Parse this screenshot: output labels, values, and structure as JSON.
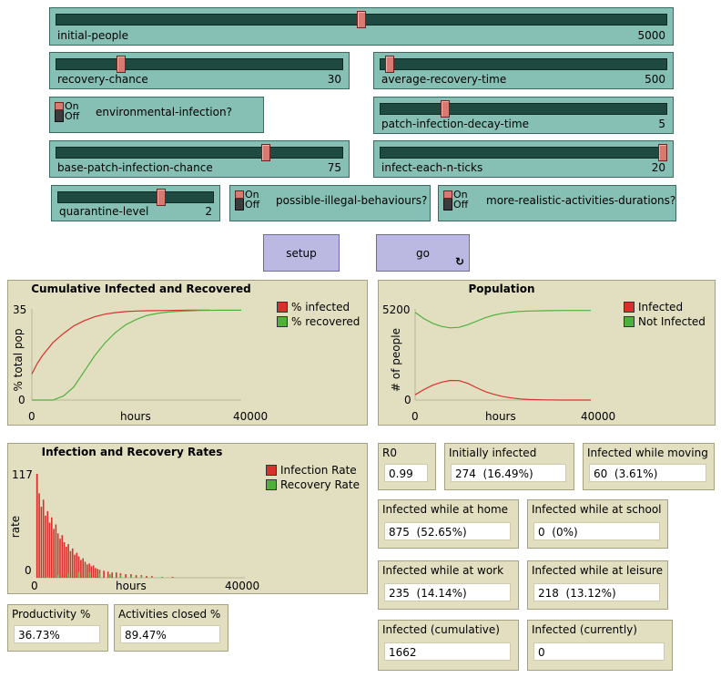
{
  "colors": {
    "slider_bg": "#86c0b4",
    "button_bg": "#bbb8e2",
    "plot_bg": "#e2dfc1",
    "infected": "#d8302a",
    "recovered": "#4eb13a",
    "thumb": "#d97a72"
  },
  "sliders": {
    "initial_people": {
      "label": "initial-people",
      "value": "5000",
      "fraction": 0.5
    },
    "recovery_chance": {
      "label": "recovery-chance",
      "value": "30",
      "fraction": 0.22
    },
    "average_recovery_time": {
      "label": "average-recovery-time",
      "value": "500",
      "fraction": 0.02
    },
    "patch_infection_decay_time": {
      "label": "patch-infection-decay-time",
      "value": "5",
      "fraction": 0.22
    },
    "base_patch_infection_chance": {
      "label": "base-patch-infection-chance",
      "value": "75",
      "fraction": 0.74
    },
    "infect_each_n_ticks": {
      "label": "infect-each-n-ticks",
      "value": "20",
      "fraction": 1.0
    },
    "quarantine_level": {
      "label": "quarantine-level",
      "value": "2",
      "fraction": 0.67
    }
  },
  "switches": {
    "environmental_infection": {
      "label": "environmental-infection?",
      "on": "On",
      "off": "Off",
      "state": "off"
    },
    "possible_illegal_behaviours": {
      "label": "possible-illegal-behaviours?",
      "on": "On",
      "off": "Off",
      "state": "off"
    },
    "more_realistic_activities_durations": {
      "label": "more-realistic-activities-durations?",
      "on": "On",
      "off": "Off",
      "state": "off"
    }
  },
  "buttons": {
    "setup": {
      "label": "setup"
    },
    "go": {
      "label": "go",
      "forever_icon": "forever-loop-icon"
    }
  },
  "plots": {
    "cumulative": {
      "title": "Cumulative Infected and Recovered",
      "y_max": "35",
      "y_min": "0",
      "x_min": "0",
      "x_max": "40000",
      "xlabel": "hours",
      "ylabel": "% total pop",
      "legend": [
        {
          "name": "% infected",
          "color": "#d8302a"
        },
        {
          "name": "% recovered",
          "color": "#4eb13a"
        }
      ]
    },
    "population": {
      "title": "Population",
      "y_max": "5200",
      "y_min": "0",
      "x_min": "0",
      "x_max": "40000",
      "xlabel": "hours",
      "ylabel": "# of people",
      "legend": [
        {
          "name": "Infected",
          "color": "#d8302a"
        },
        {
          "name": "Not Infected",
          "color": "#4eb13a"
        }
      ]
    },
    "rates": {
      "title": "Infection and Recovery Rates",
      "y_max": "117",
      "y_min": "0",
      "x_min": "0",
      "x_max": "40000",
      "xlabel": "hours",
      "ylabel": "rate",
      "legend": [
        {
          "name": "Infection Rate",
          "color": "#d8302a"
        },
        {
          "name": "Recovery Rate",
          "color": "#4eb13a"
        }
      ]
    }
  },
  "monitors": {
    "r0": {
      "label": "R0",
      "value": "0.99"
    },
    "initially_infected": {
      "label": "Initially infected",
      "value": "274  (16.49%)"
    },
    "infected_while_moving": {
      "label": "Infected while moving",
      "value": "60  (3.61%)"
    },
    "infected_at_home": {
      "label": "Infected while at home",
      "value": "875  (52.65%)"
    },
    "infected_at_school": {
      "label": "Infected while at school",
      "value": "0  (0%)"
    },
    "infected_at_work": {
      "label": "Infected while at work",
      "value": "235  (14.14%)"
    },
    "infected_at_leisure": {
      "label": "Infected while at leisure",
      "value": "218  (13.12%)"
    },
    "infected_cumulative": {
      "label": "Infected (cumulative)",
      "value": "1662"
    },
    "infected_currently": {
      "label": "Infected (currently)",
      "value": "0"
    },
    "productivity": {
      "label": "Productivity %",
      "value": "36.73%"
    },
    "activities_closed": {
      "label": "Activities closed %",
      "value": "89.47%"
    }
  },
  "chart_data": [
    {
      "type": "line",
      "title": "Cumulative Infected and Recovered",
      "xlabel": "hours",
      "ylabel": "% total pop",
      "xlim": [
        0,
        40000
      ],
      "ylim": [
        0,
        35
      ],
      "legend_position": "right",
      "series": [
        {
          "name": "% infected",
          "color": "#d8302a",
          "x": [
            0,
            1000,
            2000,
            4000,
            6000,
            8000,
            10000,
            12000,
            14000,
            16000,
            18000,
            20000,
            22000,
            26000,
            30000,
            34000
          ],
          "y": [
            10,
            14,
            17,
            22,
            25.5,
            28.5,
            30.5,
            32,
            33,
            33.6,
            34,
            34.2,
            34.3,
            34.4,
            34.5,
            34.5
          ]
        },
        {
          "name": "% recovered",
          "color": "#4eb13a",
          "x": [
            0,
            4000,
            6000,
            8000,
            10000,
            12000,
            14000,
            16000,
            18000,
            20000,
            22000,
            24000,
            26000,
            28000,
            32000,
            36000,
            40000
          ],
          "y": [
            0,
            0,
            1.5,
            5,
            11,
            17,
            22,
            26,
            29,
            31,
            32.5,
            33.3,
            33.8,
            34.1,
            34.4,
            34.5,
            34.5
          ]
        }
      ]
    },
    {
      "type": "line",
      "title": "Population",
      "xlabel": "hours",
      "ylabel": "# of people",
      "xlim": [
        0,
        40000
      ],
      "ylim": [
        0,
        5200
      ],
      "legend_position": "right",
      "series": [
        {
          "name": "Infected",
          "color": "#d8302a",
          "x": [
            0,
            2000,
            4000,
            6000,
            8000,
            10000,
            12000,
            14000,
            16000,
            18000,
            20000,
            22000,
            24000,
            26000,
            30000,
            34000,
            40000
          ],
          "y": [
            300,
            600,
            850,
            1020,
            1120,
            1110,
            950,
            700,
            480,
            320,
            200,
            120,
            60,
            30,
            10,
            0,
            0
          ]
        },
        {
          "name": "Not Infected",
          "color": "#4eb13a",
          "x": [
            0,
            2000,
            4000,
            6000,
            8000,
            10000,
            12000,
            14000,
            16000,
            18000,
            20000,
            22000,
            24000,
            26000,
            30000,
            34000,
            40000
          ],
          "y": [
            5000,
            4650,
            4380,
            4200,
            4120,
            4150,
            4300,
            4500,
            4700,
            4850,
            4950,
            5020,
            5060,
            5080,
            5100,
            5110,
            5110
          ]
        }
      ]
    },
    {
      "type": "bar",
      "title": "Infection and Recovery Rates",
      "xlabel": "hours",
      "ylabel": "rate",
      "xlim": [
        0,
        40000
      ],
      "ylim": [
        0,
        117
      ],
      "legend_position": "right",
      "series": [
        {
          "name": "Infection Rate",
          "color": "#d8302a",
          "x": [
            0,
            400,
            800,
            1200,
            1600,
            2000,
            2400,
            2800,
            3200,
            3600,
            4000,
            4400,
            4800,
            5200,
            5600,
            6000,
            6400,
            6800,
            7200,
            7600,
            8000,
            8400,
            8800,
            9200,
            9600,
            10000,
            10400,
            10800,
            11200,
            11600,
            12000,
            12800,
            13600,
            14400,
            15200,
            16000,
            17000,
            18000,
            19000,
            20000,
            21000,
            22000,
            24000,
            26000
          ],
          "y": [
            117,
            95,
            80,
            88,
            70,
            75,
            62,
            68,
            55,
            60,
            50,
            44,
            48,
            40,
            35,
            38,
            30,
            33,
            26,
            28,
            24,
            20,
            22,
            18,
            15,
            16,
            13,
            14,
            11,
            10,
            9,
            8,
            7,
            6,
            6,
            5,
            4,
            4,
            3,
            3,
            2,
            2,
            1,
            1
          ]
        },
        {
          "name": "Recovery Rate",
          "color": "#4eb13a",
          "x": [
            0,
            2000,
            4000,
            6000,
            8000,
            10000,
            12000,
            14000,
            16000,
            18000,
            20000,
            22000,
            24000
          ],
          "y": [
            0,
            1,
            3,
            5,
            6,
            6,
            5,
            4,
            3,
            2,
            2,
            1,
            1
          ]
        }
      ]
    }
  ]
}
